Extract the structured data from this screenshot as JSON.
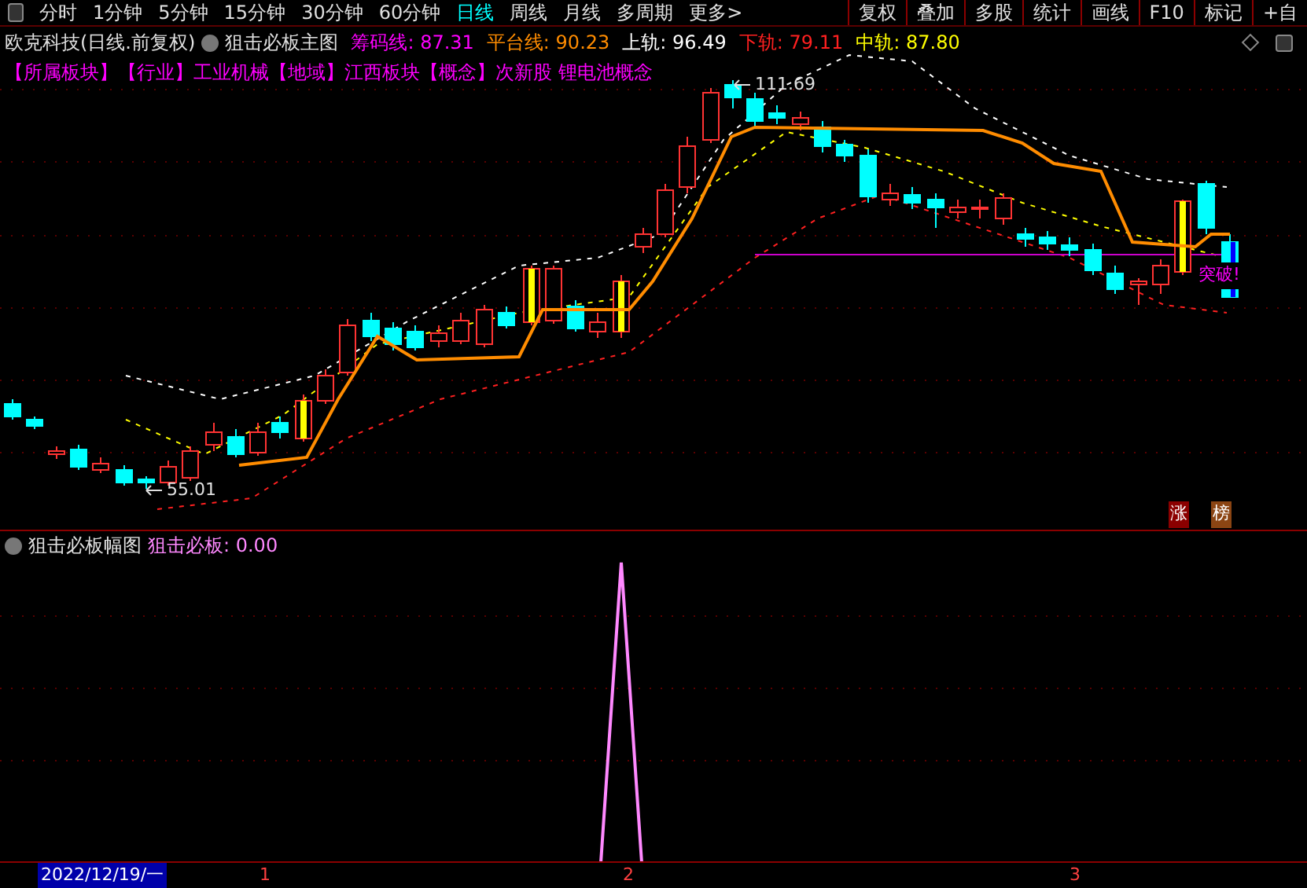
{
  "toolbar": {
    "periods": [
      {
        "label": "分时",
        "selected": false
      },
      {
        "label": "1分钟",
        "selected": false
      },
      {
        "label": "5分钟",
        "selected": false
      },
      {
        "label": "15分钟",
        "selected": false
      },
      {
        "label": "30分钟",
        "selected": false
      },
      {
        "label": "60分钟",
        "selected": false
      },
      {
        "label": "日线",
        "selected": true
      },
      {
        "label": "周线",
        "selected": false
      },
      {
        "label": "月线",
        "selected": false
      },
      {
        "label": "多周期",
        "selected": false
      },
      {
        "label": "更多>",
        "selected": false
      }
    ],
    "buttons": [
      "复权",
      "叠加",
      "多股",
      "统计",
      "画线",
      "F10",
      "标记",
      "+自"
    ]
  },
  "main_chart": {
    "title": "欧克科技(日线.前复权)",
    "indicator": "狙击必板主图",
    "readings": [
      {
        "label": "筹码线:",
        "value": "87.31",
        "color": "#ff00ff"
      },
      {
        "label": "平台线:",
        "value": "90.23",
        "color": "#ff8c00"
      },
      {
        "label": "上轨:",
        "value": "96.49",
        "color": "#ffffff"
      },
      {
        "label": "下轨:",
        "value": "79.11",
        "color": "#ff2020"
      },
      {
        "label": "中轨:",
        "value": "87.80",
        "color": "#ffff00"
      }
    ],
    "tags": "【所属板块】【行业】工业机械【地域】江西板块【概念】次新股 锂电池概念",
    "high_label": "111.69",
    "low_label": "55.01",
    "signal_label": "突破!",
    "badges": [
      {
        "label": "涨",
        "color": "#8b0000"
      },
      {
        "label": "榜",
        "color": "#8b4513"
      }
    ]
  },
  "sub_chart": {
    "indicator": "狙击必板幅图",
    "reading": "狙击必板: 0.00"
  },
  "axis": {
    "date": "2022/12/19/一",
    "ticks": [
      "1",
      "2",
      "3"
    ]
  }
}
